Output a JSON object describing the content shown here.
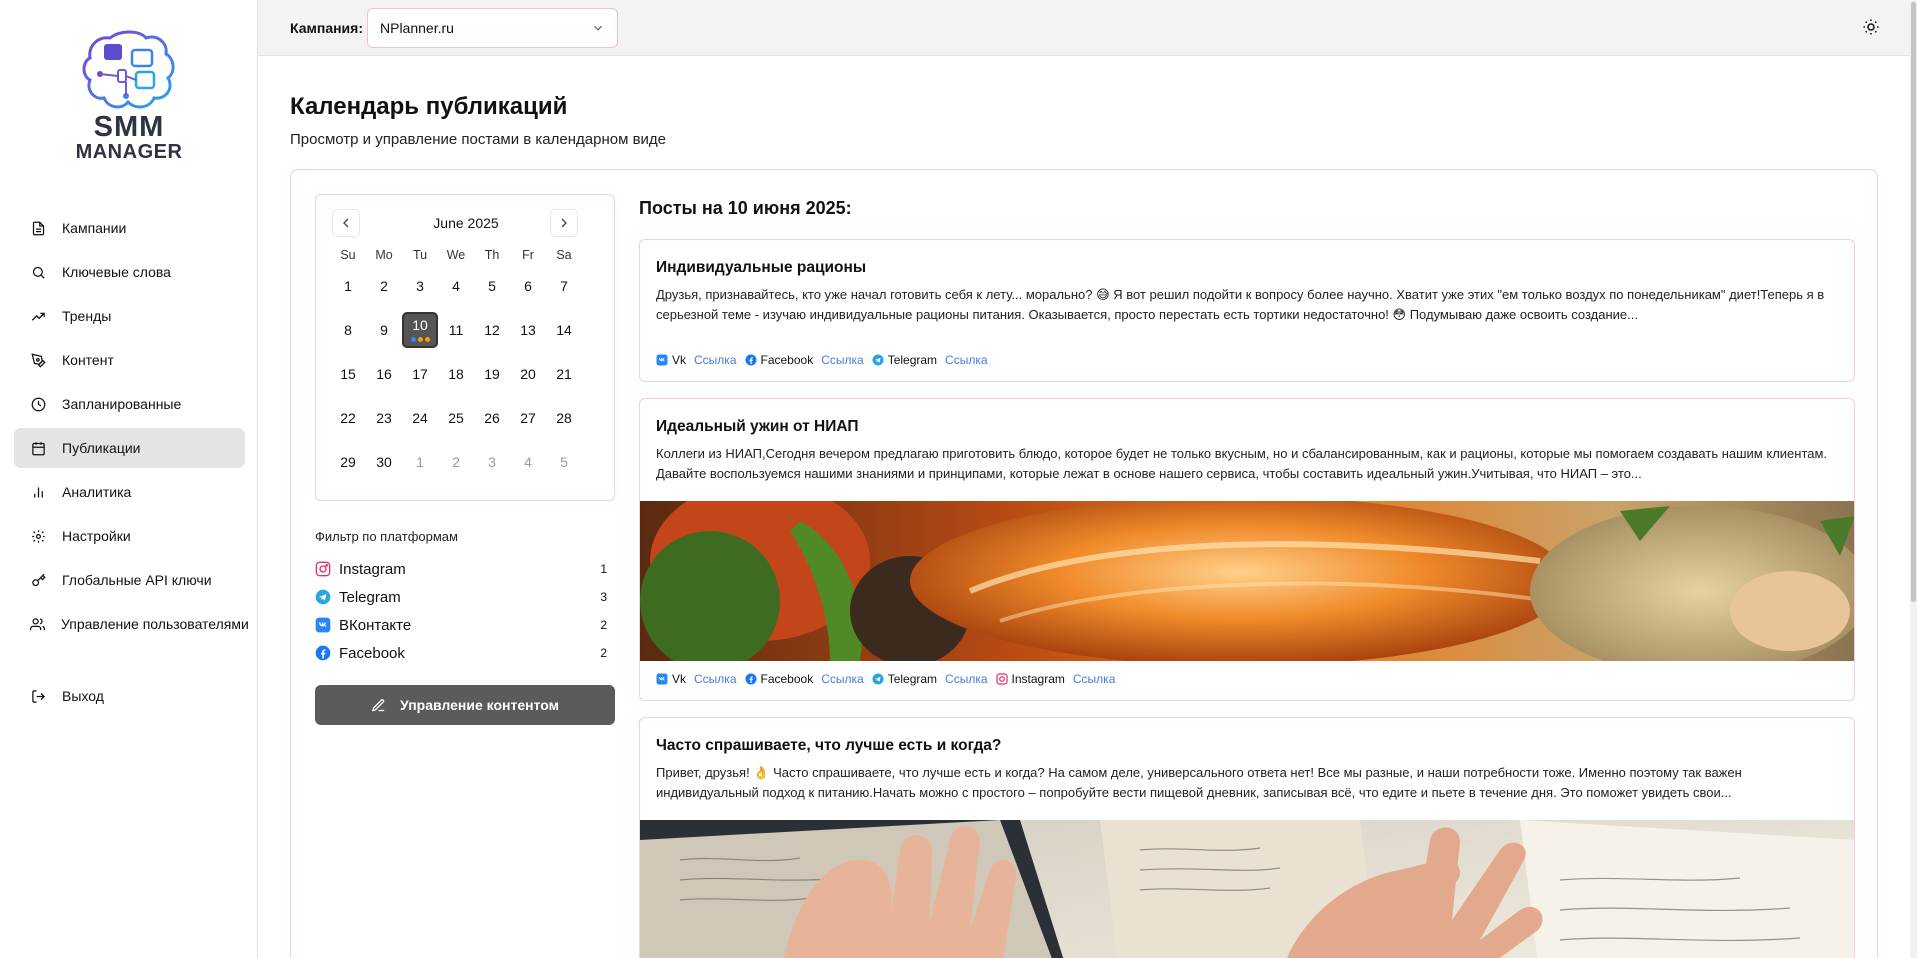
{
  "sidebar": {
    "logo": {
      "line1": "SMM",
      "line2": "MANAGER"
    },
    "items": [
      {
        "label": "Кампании",
        "icon": "file-text-icon"
      },
      {
        "label": "Ключевые слова",
        "icon": "search-icon"
      },
      {
        "label": "Тренды",
        "icon": "trending-up-icon"
      },
      {
        "label": "Контент",
        "icon": "pen-tool-icon"
      },
      {
        "label": "Запланированные",
        "icon": "clock-icon"
      },
      {
        "label": "Публикации",
        "icon": "calendar-icon",
        "active": true
      },
      {
        "label": "Аналитика",
        "icon": "bar-chart-icon"
      },
      {
        "label": "Настройки",
        "icon": "gear-icon"
      },
      {
        "label": "Глобальные API ключи",
        "icon": "key-icon"
      },
      {
        "label": "Управление пользователями",
        "icon": "users-icon"
      }
    ],
    "logout": {
      "label": "Выход",
      "icon": "log-out-icon"
    }
  },
  "header": {
    "campaign_label": "Кампания:",
    "campaign_value": "NPlanner.ru",
    "theme_icon": "sun-icon"
  },
  "page": {
    "title": "Календарь публикаций",
    "subtitle": "Просмотр и управление постами в календарном виде"
  },
  "calendar": {
    "month": "June 2025",
    "weekdays": [
      "Su",
      "Mo",
      "Tu",
      "We",
      "Th",
      "Fr",
      "Sa"
    ],
    "days": [
      {
        "n": "1"
      },
      {
        "n": "2"
      },
      {
        "n": "3"
      },
      {
        "n": "4"
      },
      {
        "n": "5"
      },
      {
        "n": "6"
      },
      {
        "n": "7"
      },
      {
        "n": "8"
      },
      {
        "n": "9"
      },
      {
        "n": "10",
        "selected": true
      },
      {
        "n": "11"
      },
      {
        "n": "12"
      },
      {
        "n": "13"
      },
      {
        "n": "14"
      },
      {
        "n": "15"
      },
      {
        "n": "16"
      },
      {
        "n": "17"
      },
      {
        "n": "18"
      },
      {
        "n": "19"
      },
      {
        "n": "20"
      },
      {
        "n": "21"
      },
      {
        "n": "22"
      },
      {
        "n": "23"
      },
      {
        "n": "24"
      },
      {
        "n": "25"
      },
      {
        "n": "26"
      },
      {
        "n": "27"
      },
      {
        "n": "28"
      },
      {
        "n": "29"
      },
      {
        "n": "30"
      },
      {
        "n": "1",
        "other": true
      },
      {
        "n": "2",
        "other": true
      },
      {
        "n": "3",
        "other": true
      },
      {
        "n": "4",
        "other": true
      },
      {
        "n": "5",
        "other": true
      }
    ],
    "selected_dots": [
      "#3b82f6",
      "#f59e0b",
      "#f59e0b"
    ]
  },
  "filter": {
    "title": "Фильтр по платформам",
    "platforms": [
      {
        "name": "Instagram",
        "count": "1",
        "icon": "instagram-icon",
        "color": "#e1306c"
      },
      {
        "name": "Telegram",
        "count": "3",
        "icon": "telegram-icon",
        "color": "#2aa3df"
      },
      {
        "name": "ВКонтакте",
        "count": "2",
        "icon": "vk-icon",
        "color": "#2787f5"
      },
      {
        "name": "Facebook",
        "count": "2",
        "icon": "facebook-icon",
        "color": "#1877f2"
      }
    ]
  },
  "manage_button": {
    "label": "Управление контентом",
    "icon": "pencil-icon"
  },
  "posts_heading": "Посты на 10 июня 2025:",
  "posts": [
    {
      "title": "Индивидуальные рационы",
      "text": "Друзья, признавайтесь, кто уже начал готовить себя к лету... морально? 😅 Я вот решил подойти к вопросу более научно. Хватит уже этих \"ем только воздух по понедельникам\" диет!Теперь я в серьезной теме - изучаю индивидуальные рационы питания. Оказывается, просто перестать есть тортики недостаточно! 😳 Подумываю даже освоить создание...",
      "links": [
        {
          "platform": "Vk",
          "link": "Ссылка",
          "icon": "vk-icon"
        },
        {
          "platform": "Facebook",
          "link": "Ссылка",
          "icon": "facebook-icon"
        },
        {
          "platform": "Telegram",
          "link": "Ссылка",
          "icon": "telegram-icon"
        }
      ]
    },
    {
      "title": "Идеальный ужин от НИАП",
      "text": "Коллеги из НИАП,Сегодня вечером предлагаю приготовить блюдо, которое будет не только вкусным, но и сбалансированным, как и рационы, которые мы помогаем создавать нашим клиентам. Давайте воспользуемся нашими знаниями и принципами, которые лежат в основе нашего сервиса, чтобы составить идеальный ужин.Учитывая, что НИАП – это...",
      "links": [
        {
          "platform": "Vk",
          "link": "Ссылка",
          "icon": "vk-icon"
        },
        {
          "platform": "Facebook",
          "link": "Ссылка",
          "icon": "facebook-icon"
        },
        {
          "platform": "Telegram",
          "link": "Ссылка",
          "icon": "telegram-icon"
        },
        {
          "platform": "Instagram",
          "link": "Ссылка",
          "icon": "instagram-icon"
        }
      ],
      "image": "salmon-dish-photo"
    },
    {
      "title": "Часто спрашиваете, что лучше есть и когда?",
      "text": "Привет, друзья! 👌 Часто спрашиваете, что лучше есть и когда? На самом деле, универсального ответа нет! Все мы разные, и наши потребности тоже. Именно поэтому так важен индивидуальный подход к питанию.Начать можно с простого – попробуйте вести пищевой дневник, записывая всё, что едите и пьете в течение дня. Это поможет увидеть свои...",
      "image": "hands-notebook-photo"
    }
  ]
}
